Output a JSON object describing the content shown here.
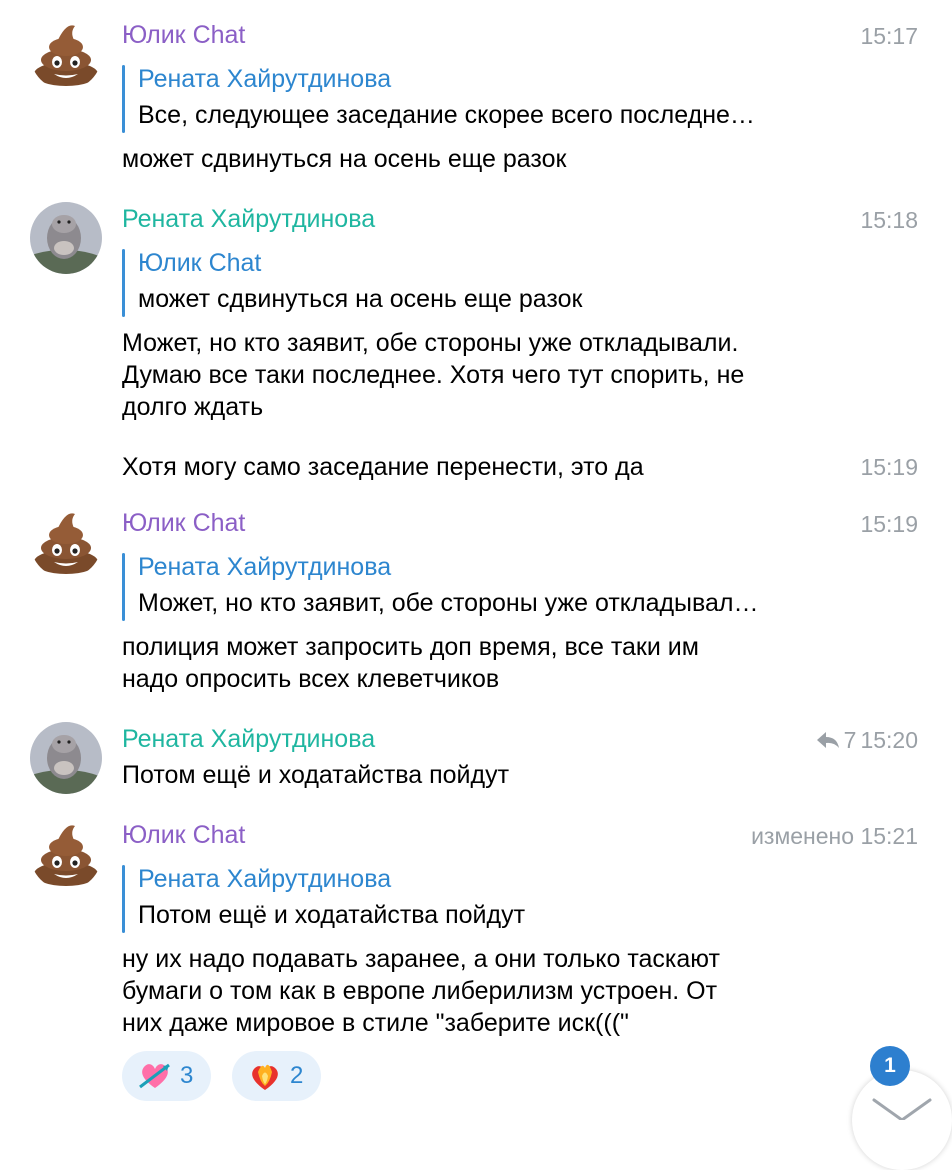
{
  "messages": [
    {
      "sender": "Юлик Chat",
      "time": "15:17",
      "reply_name": "Рената Хайрутдинова",
      "reply_text": "Все, следующее заседание скорее всего последне…",
      "text": "может сдвинуться на осень еще разок"
    },
    {
      "sender": "Рената Хайрутдинова",
      "time": "15:18",
      "reply_name": "Юлик Chat",
      "reply_text": "может сдвинуться на осень еще разок",
      "text": "Может, но кто заявит, обе стороны уже откладывали.\nДумаю все таки последнее. Хотя чего тут спорить, не\nдолго ждать"
    },
    {
      "time": "15:19",
      "text": "Хотя могу само заседание перенести, это да"
    },
    {
      "sender": "Юлик Chat",
      "time": "15:19",
      "reply_name": "Рената Хайрутдинова",
      "reply_text": "Может, но кто заявит, обе стороны уже откладывал…",
      "text": "полиция может запросить доп время, все таки им\nнадо опросить всех клеветчиков"
    },
    {
      "sender": "Рената Хайрутдинова",
      "replies_count": "7",
      "time": "15:20",
      "text": "Потом ещё и ходатайства пойдут"
    },
    {
      "sender": "Юлик Chat",
      "edited_label": "изменено",
      "time": "15:21",
      "reply_name": "Рената Хайрутдинова",
      "reply_text": "Потом ещё и ходатайства пойдут",
      "text": "ну их надо подавать заранее, а они только таскают\nбумаги о том как в европе либерилизм устроен. От\nних даже мировое в стиле \"заберите иск(((\""
    }
  ],
  "reactions": [
    {
      "emoji": "heart-with-arrow",
      "count": "3"
    },
    {
      "emoji": "heart-on-fire",
      "count": "2"
    }
  ],
  "unread_badge": "1",
  "colors": {
    "sender_purple": "#8b5fc6",
    "sender_teal": "#1fb6a0",
    "reply_blue": "#2d86cf",
    "time_gray": "#9aa0a6"
  }
}
